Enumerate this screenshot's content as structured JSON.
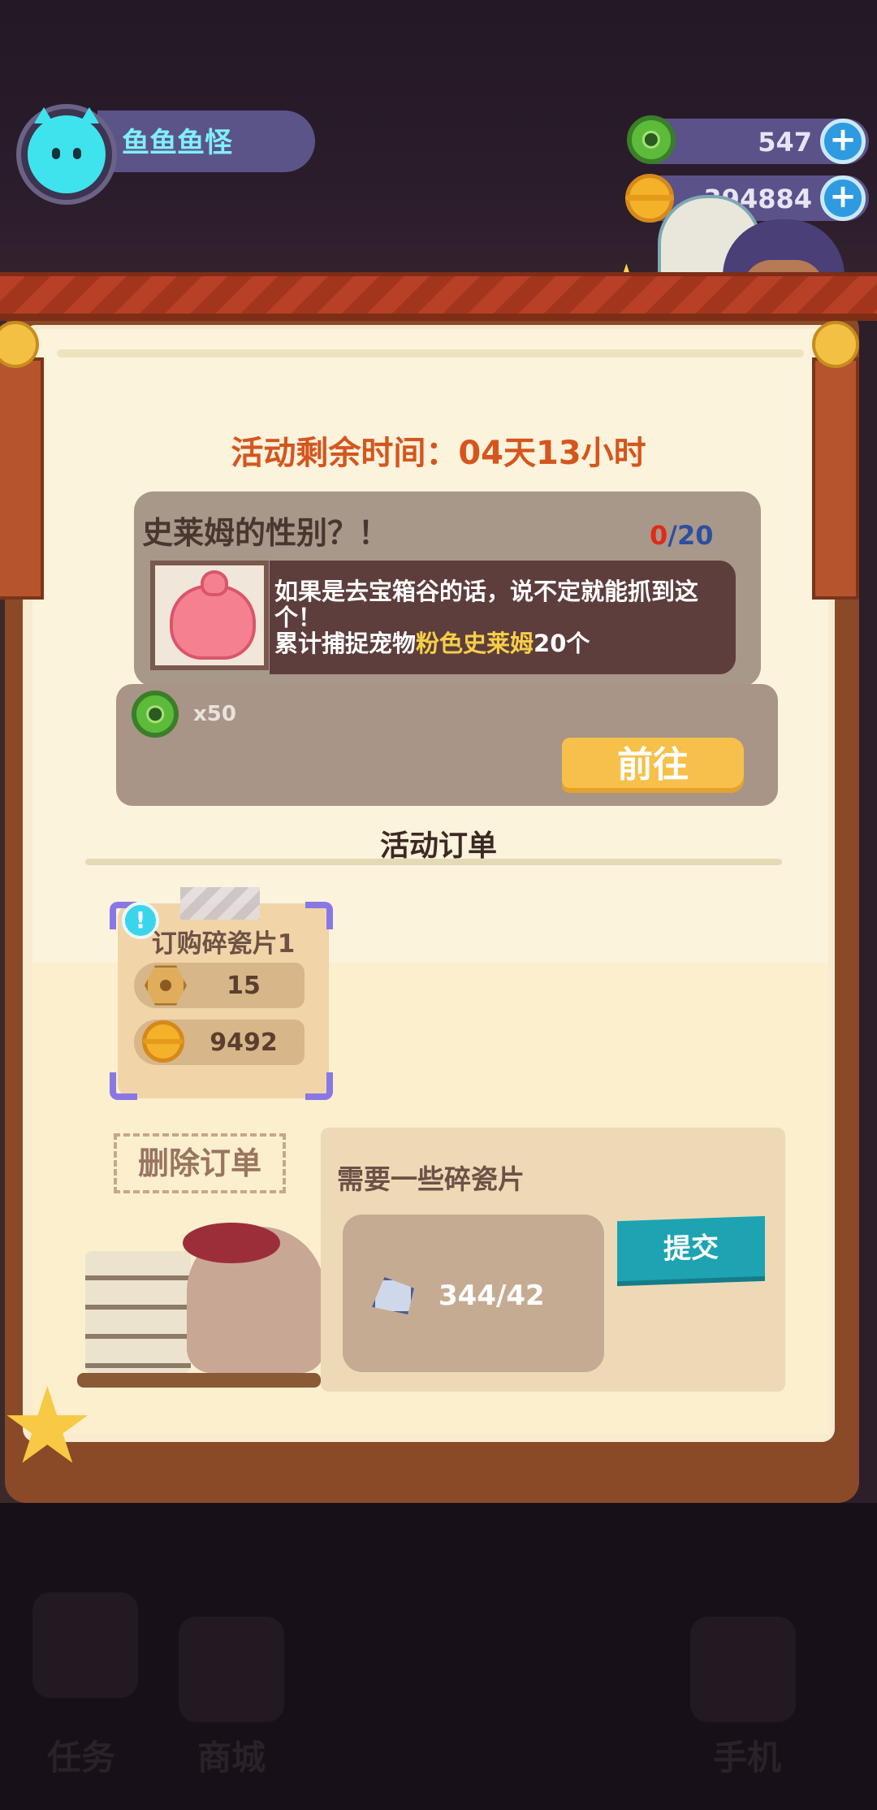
{
  "player": {
    "name": "鱼鱼鱼怪"
  },
  "resources": {
    "gems": {
      "value": "547",
      "icon": "green-donut-icon"
    },
    "coins": {
      "value": "394884",
      "icon": "gold-planet-coin-icon"
    }
  },
  "event": {
    "timer_text": "活动剩余时间：04天13小时",
    "quest": {
      "title": "史莱姆的性别？！",
      "progress_current": "0",
      "progress_total": "/20",
      "desc_line1": "如果是去宝箱谷的话，说不定就能抓到这个！",
      "desc_line2_prefix": "累计捕捉宠物",
      "desc_line2_highlight": "粉色史莱姆",
      "desc_line2_suffix": "20个",
      "reward_qty": "x50",
      "go_label": "前往"
    },
    "orders_title": "活动订单",
    "order": {
      "name": "订购碎瓷片1",
      "alert": "!",
      "reward_nuts": "15",
      "reward_coins": "9492"
    },
    "delete_label": "删除订单",
    "need": {
      "title": "需要一些碎瓷片",
      "progress": "344/42",
      "submit_label": "提交"
    }
  },
  "nav": {
    "tasks": "任务",
    "shop": "商城",
    "phone": "手机"
  },
  "colors": {
    "timer": "#d4561e",
    "highlight": "#f6cf47",
    "go_button": "#f6c04a",
    "submit_button": "#1ea3b3",
    "order_corner": "#8a77e6"
  }
}
